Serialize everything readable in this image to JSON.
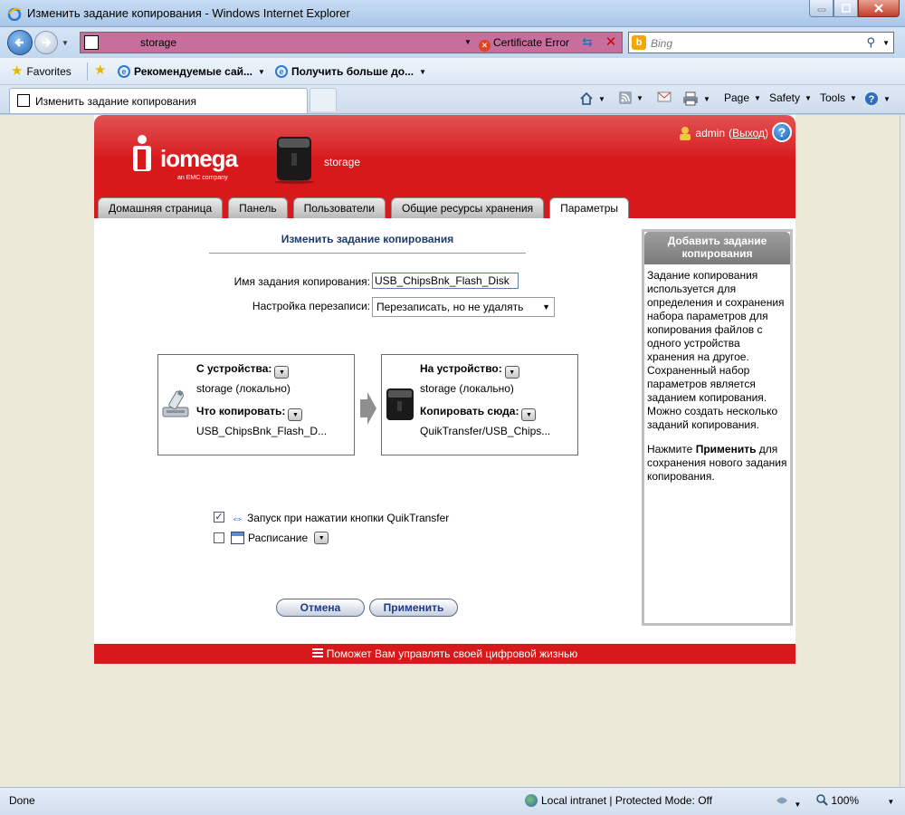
{
  "window": {
    "title": "Изменить задание копирования - Windows Internet Explorer"
  },
  "browser": {
    "address": "storage",
    "cert_error": "Certificate Error",
    "search_placeholder": "Bing",
    "favorites_label": "Favorites",
    "fav_items": [
      {
        "label": "Рекомендуемые сай..."
      },
      {
        "label": "Получить больше до..."
      }
    ],
    "tab_title": "Изменить задание копирования",
    "commands": {
      "page": "Page",
      "safety": "Safety",
      "tools": "Tools"
    }
  },
  "app": {
    "logo": {
      "word": "iomega",
      "sub": "an EMC company"
    },
    "device_name": "storage",
    "user": {
      "name": "admin",
      "logout": "Выход"
    },
    "nav": [
      {
        "label": "Домашняя страница"
      },
      {
        "label": "Панель"
      },
      {
        "label": "Пользователи"
      },
      {
        "label": "Общие ресурсы хранения"
      },
      {
        "label": "Параметры"
      }
    ],
    "active_tab": "Параметры",
    "page_title": "Изменить задание копирования",
    "form": {
      "name_label": "Имя задания копирования:",
      "name_value": "USB_ChipsBnk_Flash_Disk",
      "overwrite_label": "Настройка перезаписи:",
      "overwrite_value": "Перезаписать, но не удалять"
    },
    "source": {
      "device_label": "С устройства:",
      "device_value": "storage (локально)",
      "what_label": "Что копировать:",
      "what_value": "USB_ChipsBnk_Flash_D..."
    },
    "target": {
      "device_label": "На устройство:",
      "device_value": "storage (локально)",
      "where_label": "Копировать сюда:",
      "where_value": "QuikTransfer/USB_Chips..."
    },
    "options": {
      "quiktransfer_label": "Запуск при нажатии кнопки QuikTransfer",
      "quiktransfer_checked": true,
      "schedule_label": "Расписание",
      "schedule_checked": false
    },
    "buttons": {
      "cancel": "Отмена",
      "apply": "Применить"
    },
    "sidebar": {
      "title": "Добавить задание копирования",
      "text1": "Задание копирования используется для определения и сохранения набора параметров для копирования файлов с одного устройства хранения на другое. Сохраненный набор параметров является заданием копирования. Можно создать несколько заданий копирования.",
      "text2_pre": "Нажмите ",
      "text2_bold": "Применить",
      "text2_post": " для сохранения нового задания копирования."
    },
    "footer": "Поможет Вам управлять своей цифровой жизнью"
  },
  "status": {
    "left": "Done",
    "zone": "Local intranet | Protected Mode: Off",
    "zoom": "100%"
  },
  "colors": {
    "brand_red": "#d8191b",
    "title_blue": "#1f3a6c",
    "address_error": "#c76f9c"
  }
}
